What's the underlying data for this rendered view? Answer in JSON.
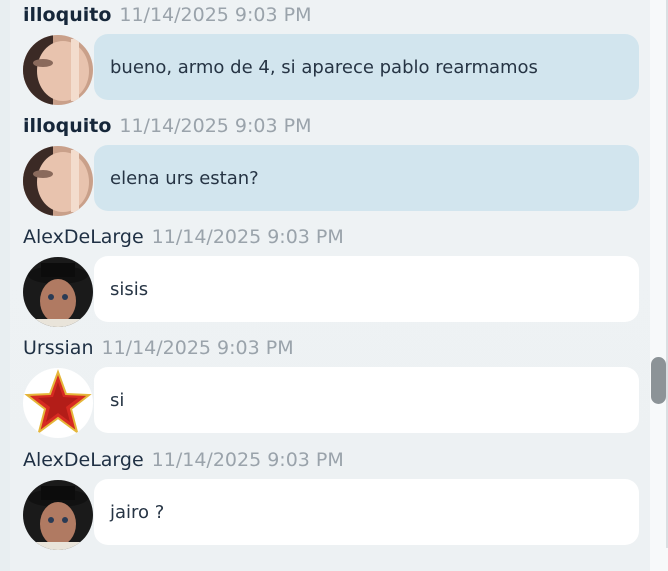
{
  "messages": [
    {
      "author": "illoquito",
      "timestamp": "11/14/2025 9:03 PM",
      "text": "bueno, armo de 4, si aparece pablo rearmamos",
      "own": true,
      "avatar": "illoquito-avatar"
    },
    {
      "author": "illoquito",
      "timestamp": "11/14/2025 9:03 PM",
      "text": "elena urs estan?",
      "own": true,
      "avatar": "illoquito-avatar"
    },
    {
      "author": "AlexDeLarge",
      "timestamp": "11/14/2025 9:03 PM",
      "text": "sisis",
      "own": false,
      "avatar": "alexdelarge-avatar"
    },
    {
      "author": "Urssian",
      "timestamp": "11/14/2025 9:03 PM",
      "text": "si",
      "own": false,
      "avatar": "urssian-star-avatar"
    },
    {
      "author": "AlexDeLarge",
      "timestamp": "11/14/2025 9:03 PM",
      "text": "jairo ?",
      "own": false,
      "avatar": "alexdelarge-avatar"
    }
  ],
  "colors": {
    "own_bubble": "#d2e5ee",
    "other_bubble": "#ffffff",
    "timestamp": "#9aa3ab",
    "author": "#1f3044"
  }
}
